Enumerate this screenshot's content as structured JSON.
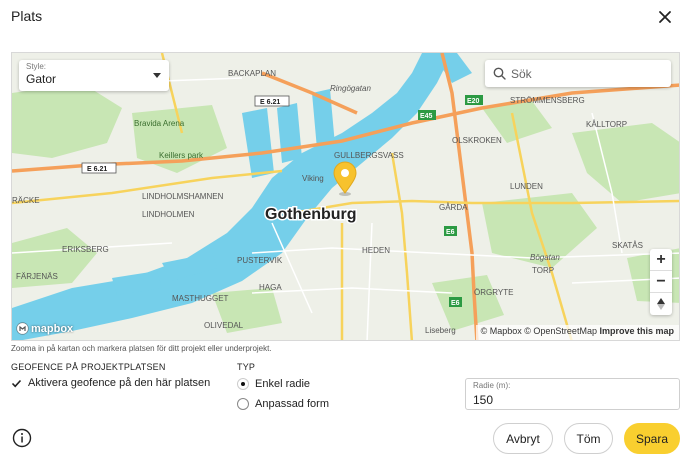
{
  "dialog": {
    "title": "Plats",
    "close_icon": "close-icon"
  },
  "map": {
    "style_label": "Style:",
    "style_value": "Gator",
    "search_placeholder": "Sök",
    "zoom_in": "+",
    "zoom_out": "−",
    "compass": "▲",
    "attribution_mapbox": "© Mapbox",
    "attribution_osm": "© OpenStreetMap",
    "attribution_improve": "Improve this map",
    "logo_text": "mapbox",
    "city_label": "Gothenburg",
    "place_labels": [
      "BACKAPLAN",
      "Ringögatan",
      "Bravida Arena",
      "Keillers park",
      "GULLBERGSVASS",
      "OLSKROKEN",
      "STRÖMMENSBERG",
      "KÅLLTORP",
      "LINDHOLMSHAMNEN",
      "LINDHOLMEN",
      "Viking",
      "GÅRDA",
      "LUNDEN",
      "ERIKSBERG",
      "FÄRJENÄS",
      "PUSTERVIK",
      "HEDEN",
      "SKATÅS",
      "Bögatan",
      "TORP",
      "MASTHUGGET",
      "HAGA",
      "ÖRGRYTE",
      "OLIVEDAL",
      "Liseberg",
      "RÄCKE"
    ],
    "road_labels": [
      "E 6.21",
      "E 6.21",
      "E45",
      "E20",
      "E6",
      "E6"
    ],
    "hint": "Zooma in på kartan och markera platsen för ditt projekt eller underprojekt."
  },
  "geofence": {
    "heading": "GEOFENCE PÅ PROJEKTPLATSEN",
    "checkbox_label": "Aktivera geofence på den här platsen",
    "checked": true
  },
  "type": {
    "heading": "TYP",
    "options": [
      {
        "label": "Enkel radie",
        "selected": true
      },
      {
        "label": "Anpassad form",
        "selected": false
      }
    ]
  },
  "radius": {
    "label": "Radie (m):",
    "value": "150"
  },
  "footer": {
    "info_icon": "info-icon",
    "cancel_label": "Avbryt",
    "clear_label": "Töm",
    "save_label": "Spara",
    "save_color": "#f9cf2f"
  },
  "colors": {
    "water": "#75cfea",
    "park": "#c8e6b4",
    "motorway": "#f5a05a",
    "main_road": "#f7d35c",
    "marker": "#f7c22d"
  }
}
